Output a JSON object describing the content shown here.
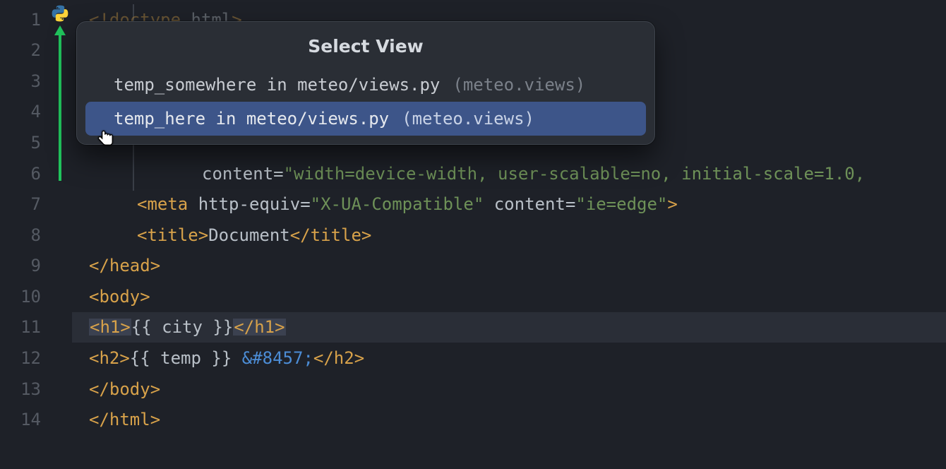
{
  "gutter": {
    "lines": [
      "1",
      "2",
      "3",
      "4",
      "5",
      "6",
      "7",
      "8",
      "9",
      "10",
      "11",
      "12",
      "13",
      "14"
    ]
  },
  "code": {
    "l1_tag": "<!doctype",
    "l1_txt": " html",
    "l1_end": ">",
    "l6_attr": "content=",
    "l6_str": "\"width=device-width, user-scalable=no, initial-scale=1.0,",
    "l7_open": "<meta",
    "l7_a1": " http-equiv=",
    "l7_s1": "\"X-UA-Compatible\"",
    "l7_a2": " content=",
    "l7_s2": "\"ie=edge\"",
    "l7_close": ">",
    "l8_ot": "<title>",
    "l8_txt": "Document",
    "l8_ct": "</title>",
    "l9": "</head>",
    "l10": "<body>",
    "l11_ot": "<h1>",
    "l11_v": "{{ city }}",
    "l11_ct": "</h1>",
    "l12_ot": "<h2>",
    "l12_v": "{{ temp }} ",
    "l12_ent": "&#8457;",
    "l12_ct": "</h2>",
    "l13": "</body>",
    "l14": "</html>"
  },
  "popup": {
    "title": "Select View",
    "items": [
      {
        "label": "temp_somewhere in meteo/views.py",
        "paren": " (meteo.views)"
      },
      {
        "label": "temp_here in meteo/views.py",
        "paren": " (meteo.views)"
      }
    ],
    "selected_index": 1
  },
  "icons": {
    "python": "python-icon",
    "arrow": "arrow-up-icon",
    "cursor": "hand-cursor-icon"
  }
}
